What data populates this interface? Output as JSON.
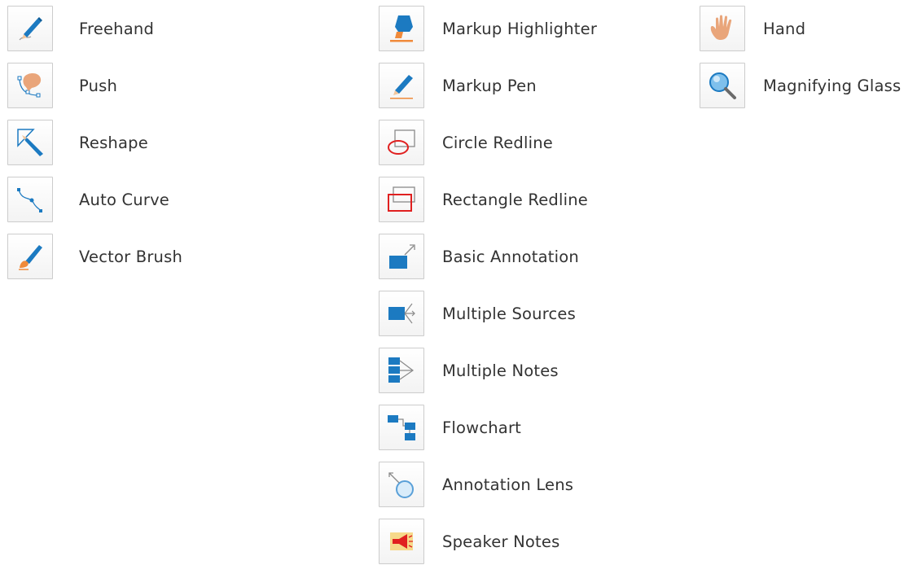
{
  "colors": {
    "blue": "#1c7ac1",
    "orange": "#f08a3a",
    "red": "#e02020",
    "skin": "#e9a57a",
    "text": "#333333",
    "icon_border": "#cccccc"
  },
  "columns": [
    {
      "tools": [
        {
          "label": "Freehand",
          "icon": "freehand-icon"
        },
        {
          "label": "Push",
          "icon": "push-icon"
        },
        {
          "label": "Reshape",
          "icon": "reshape-icon"
        },
        {
          "label": "Auto Curve",
          "icon": "auto-curve-icon"
        },
        {
          "label": "Vector Brush",
          "icon": "vector-brush-icon"
        }
      ]
    },
    {
      "tools": [
        {
          "label": "Markup Highlighter",
          "icon": "markup-highlighter-icon"
        },
        {
          "label": "Markup Pen",
          "icon": "markup-pen-icon"
        },
        {
          "label": "Circle Redline",
          "icon": "circle-redline-icon"
        },
        {
          "label": "Rectangle Redline",
          "icon": "rectangle-redline-icon"
        },
        {
          "label": "Basic Annotation",
          "icon": "basic-annotation-icon"
        },
        {
          "label": "Multiple Sources",
          "icon": "multiple-sources-icon"
        },
        {
          "label": "Multiple Notes",
          "icon": "multiple-notes-icon"
        },
        {
          "label": "Flowchart",
          "icon": "flowchart-icon"
        },
        {
          "label": "Annotation Lens",
          "icon": "annotation-lens-icon"
        },
        {
          "label": "Speaker Notes",
          "icon": "speaker-notes-icon"
        }
      ]
    },
    {
      "tools": [
        {
          "label": "Hand",
          "icon": "hand-icon"
        },
        {
          "label": "Magnifying Glass",
          "icon": "magnifying-glass-icon"
        }
      ]
    }
  ]
}
